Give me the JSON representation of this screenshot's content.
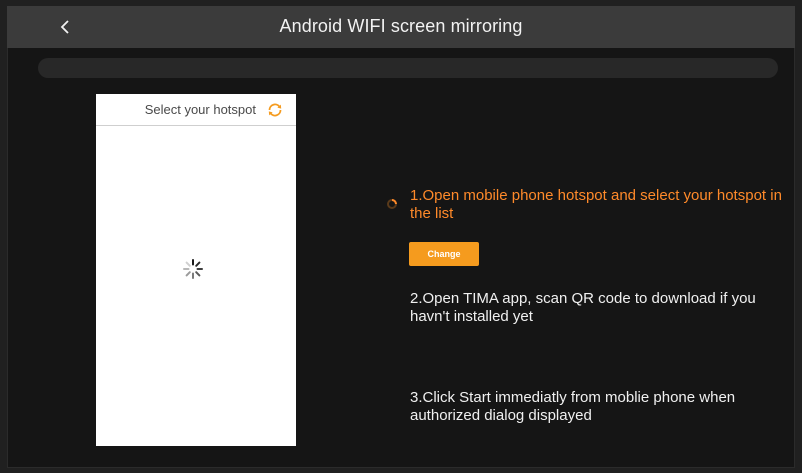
{
  "header": {
    "title": "Android WIFI screen mirroring",
    "back_icon": "chevron-left-icon"
  },
  "hotspot_panel": {
    "header_label": "Select your hotspot",
    "refresh_icon": "refresh-icon",
    "loading_icon": "spinner-icon"
  },
  "steps": {
    "step1_text": "1.Open mobile phone hotspot and select your hotspot in the list",
    "step1_indicator_icon": "loading-indicator-icon",
    "change_label": "Change",
    "step2_text": "2.Open TIMA app, scan QR code to download if you havn't installed yet",
    "step3_text": "3.Click Start immediatly from moblie phone when authorized dialog displayed"
  },
  "colors": {
    "accent": "#f59b1e",
    "active_step": "#ff8a2a",
    "background": "#151515",
    "header_bar": "#3b3b3b"
  }
}
